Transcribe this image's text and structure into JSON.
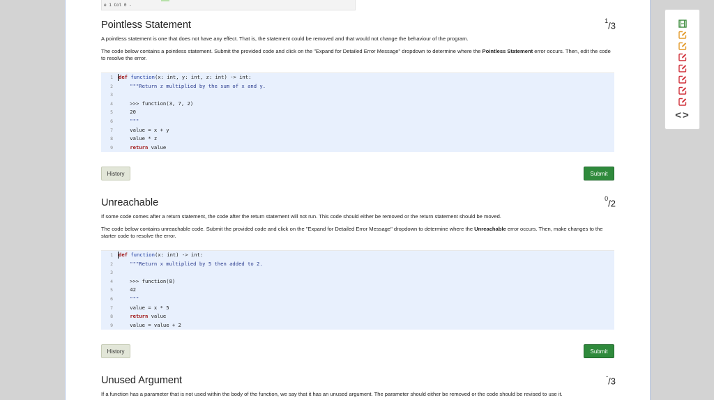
{
  "status_bar": {
    "text": "e 1 Col 0 -"
  },
  "sections": [
    {
      "title": "Pointless Statement",
      "score_num": "1",
      "score_den": "3",
      "desc1": "A pointless statement is one that does not have any effect. That is, the statement could be removed and that would not change the behaviour of the program.",
      "desc2_pre": "The code below contains a pointless statement. Submit the provided code and click on the \"Expand for Detailed Error Message\" dropdown to determine where the ",
      "desc2_bold": "Pointless Statement",
      "desc2_post": " error occurs. Then, edit the code to resolve the error.",
      "code": [
        "def function(x: int, y: int, z: int) -> int:",
        "    \"\"\"Return z multiplied by the sum of x and y.",
        "",
        "    >>> function(3, 7, 2)",
        "    20",
        "    \"\"\"",
        "    value = x + y",
        "    value * z",
        "    return value"
      ],
      "history_label": "History",
      "submit_label": "Submit"
    },
    {
      "title": "Unreachable",
      "score_num": "0",
      "score_den": "2",
      "desc1": "If some code comes after a return statement, the code after the return statement will not run. This code should either be removed or the return statement should be moved.",
      "desc2_pre": "The code below contains unreachable code. Submit the provided code and click on the \"Expand for Detailed Error Message\" dropdown to determine where the ",
      "desc2_bold": "Unreachable",
      "desc2_post": " error occurs. Then, make changes to the starter code to resolve the error.",
      "code": [
        "def function(x: int) -> int:",
        "    \"\"\"Return x multiplied by 5 then added to 2.",
        "",
        "    >>> function(8)",
        "    42",
        "    \"\"\"",
        "    value = x * 5",
        "    return value",
        "    value = value + 2"
      ],
      "history_label": "History",
      "submit_label": "Submit"
    },
    {
      "title": "Unused Argument",
      "score_num": "-",
      "score_den": "3",
      "desc1": "If a function has a parameter that is not used within the body of the function, we say that it has an unused argument. The parameter should either be removed or the code should be revised to use it."
    }
  ],
  "side_panel": {
    "icons": [
      "film-icon",
      "edit-icon",
      "edit-icon",
      "edit-icon",
      "edit-icon",
      "edit-icon",
      "edit-icon",
      "edit-icon"
    ],
    "colors": [
      "#3a8a3a",
      "#e39a2a",
      "#e39a2a",
      "#d0303a",
      "#d0303a",
      "#d0303a",
      "#d0303a",
      "#d0303a"
    ],
    "nav": "<>"
  }
}
